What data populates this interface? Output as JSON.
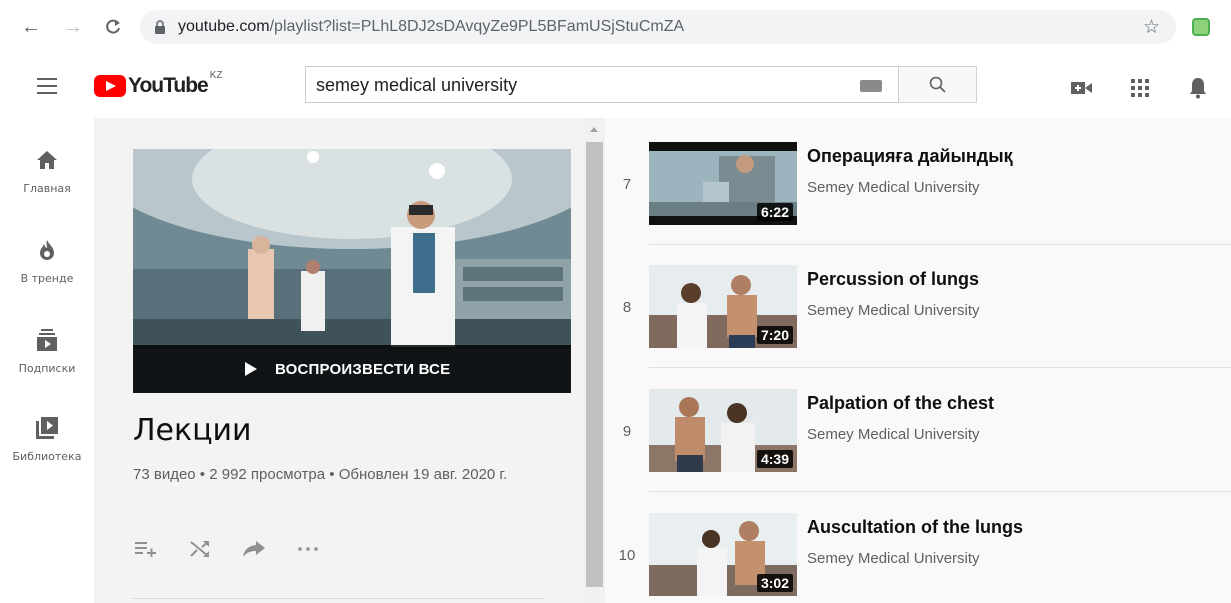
{
  "browser": {
    "url_host": "youtube.com",
    "url_path": "/playlist?list=PLhL8DJ2sDAvqyZe9PL5BFamUSjStuCmZA"
  },
  "masthead": {
    "logo_text": "YouTube",
    "region": "KZ",
    "search_value": "semey medical university"
  },
  "guide": {
    "items": [
      {
        "label": "Главная",
        "icon": "home-icon"
      },
      {
        "label": "В тренде",
        "icon": "trending-icon"
      },
      {
        "label": "Подписки",
        "icon": "subscriptions-icon"
      },
      {
        "label": "Библиотека",
        "icon": "library-icon"
      }
    ]
  },
  "playlist": {
    "play_all_label": "ВОСПРОИЗВЕСТИ ВСЕ",
    "title": "Лекции",
    "stats": "73 видео • 2 992 просмотра • Обновлен 19 авг. 2020 г."
  },
  "videos": [
    {
      "index": "7",
      "title": "Операцияға дайындық",
      "channel": "Semey Medical University",
      "duration": "6:22"
    },
    {
      "index": "8",
      "title": "Percussion of lungs",
      "channel": "Semey Medical University",
      "duration": "7:20"
    },
    {
      "index": "9",
      "title": "Palpation of the chest",
      "channel": "Semey Medical University",
      "duration": "4:39"
    },
    {
      "index": "10",
      "title": "Auscultation of the lungs",
      "channel": "Semey Medical University",
      "duration": "3:02"
    }
  ],
  "colors": {
    "brand_red": "#ff0000",
    "text_primary": "#0f0f0f",
    "text_secondary": "#606060"
  }
}
